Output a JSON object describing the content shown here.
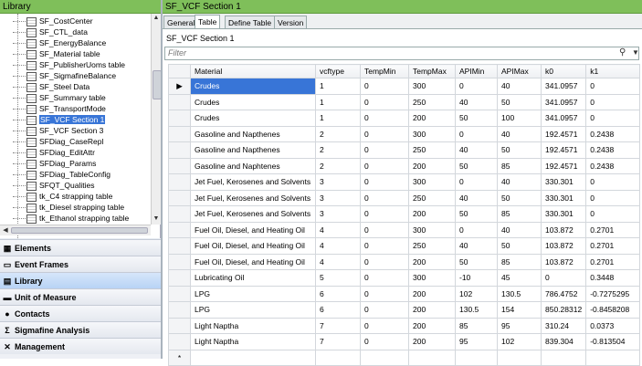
{
  "library": {
    "title": "Library",
    "tree_items": [
      {
        "label": "SF_CostCenter",
        "selected": false
      },
      {
        "label": "SF_CTL_data",
        "selected": false
      },
      {
        "label": "SF_EnergyBalance",
        "selected": false
      },
      {
        "label": "SF_Material table",
        "selected": false
      },
      {
        "label": "SF_PublisherUoms table",
        "selected": false
      },
      {
        "label": "SF_SigmafineBalance",
        "selected": false
      },
      {
        "label": "SF_Steel Data",
        "selected": false
      },
      {
        "label": "SF_Summary table",
        "selected": false
      },
      {
        "label": "SF_TransportMode",
        "selected": false
      },
      {
        "label": "SF_VCF Section 1",
        "selected": true
      },
      {
        "label": "SF_VCF Section 3",
        "selected": false
      },
      {
        "label": "SFDiag_CaseRepl",
        "selected": false
      },
      {
        "label": "SFDiag_EditAttr",
        "selected": false
      },
      {
        "label": "SFDiag_Params",
        "selected": false
      },
      {
        "label": "SFDiag_TableConfig",
        "selected": false
      },
      {
        "label": "SFQT_Qualities",
        "selected": false
      },
      {
        "label": "tk_C4 strapping table",
        "selected": false
      },
      {
        "label": "tk_Diesel strapping table",
        "selected": false
      },
      {
        "label": "tk_Ethanol strapping table",
        "selected": false
      }
    ]
  },
  "nav": [
    {
      "label": "Elements",
      "icon": "elements-icon",
      "glyph": "▦",
      "active": false
    },
    {
      "label": "Event Frames",
      "icon": "event-frames-icon",
      "glyph": "▭",
      "active": false
    },
    {
      "label": "Library",
      "icon": "library-icon",
      "glyph": "▤",
      "active": true
    },
    {
      "label": "Unit of Measure",
      "icon": "ruler-icon",
      "glyph": "▬",
      "active": false
    },
    {
      "label": "Contacts",
      "icon": "contacts-icon",
      "glyph": "●",
      "active": false
    },
    {
      "label": "Sigmafine Analysis",
      "icon": "sigma-icon",
      "glyph": "Σ",
      "active": false
    },
    {
      "label": "Management",
      "icon": "management-icon",
      "glyph": "✕",
      "active": false
    }
  ],
  "section": {
    "title": "SF_VCF Section 1",
    "tabs": [
      "General",
      "Table",
      "Define Table",
      "Version"
    ],
    "active_tab": "Table",
    "subtitle": "SF_VCF Section 1",
    "filter_placeholder": "Filter"
  },
  "grid": {
    "columns": [
      "Material",
      "vcftype",
      "TempMin",
      "TempMax",
      "APIMin",
      "APIMax",
      "k0",
      "k1"
    ],
    "rows": [
      [
        "Crudes",
        "1",
        "0",
        "300",
        "0",
        "40",
        "341.0957",
        "0"
      ],
      [
        "Crudes",
        "1",
        "0",
        "250",
        "40",
        "50",
        "341.0957",
        "0"
      ],
      [
        "Crudes",
        "1",
        "0",
        "200",
        "50",
        "100",
        "341.0957",
        "0"
      ],
      [
        "Gasoline and Napthenes",
        "2",
        "0",
        "300",
        "0",
        "40",
        "192.4571",
        "0.2438"
      ],
      [
        "Gasoline and Napthenes",
        "2",
        "0",
        "250",
        "40",
        "50",
        "192.4571",
        "0.2438"
      ],
      [
        "Gasoline and Naphtenes",
        "2",
        "0",
        "200",
        "50",
        "85",
        "192.4571",
        "0.2438"
      ],
      [
        "Jet Fuel, Kerosenes and Solvents",
        "3",
        "0",
        "300",
        "0",
        "40",
        "330.301",
        "0"
      ],
      [
        "Jet Fuel, Kerosenes and Solvents",
        "3",
        "0",
        "250",
        "40",
        "50",
        "330.301",
        "0"
      ],
      [
        "Jet Fuel, Kerosenes and Solvents",
        "3",
        "0",
        "200",
        "50",
        "85",
        "330.301",
        "0"
      ],
      [
        "Fuel Oil, Diesel, and Heating Oil",
        "4",
        "0",
        "300",
        "0",
        "40",
        "103.872",
        "0.2701"
      ],
      [
        "Fuel Oil, Diesel, and Heating Oil",
        "4",
        "0",
        "250",
        "40",
        "50",
        "103.872",
        "0.2701"
      ],
      [
        "Fuel Oil, Diesel, and Heating Oil",
        "4",
        "0",
        "200",
        "50",
        "85",
        "103.872",
        "0.2701"
      ],
      [
        "Lubricating Oil",
        "5",
        "0",
        "300",
        "-10",
        "45",
        "0",
        "0.3448"
      ],
      [
        "LPG",
        "6",
        "0",
        "200",
        "102",
        "130.5",
        "786.4752",
        "-0.7275295"
      ],
      [
        "LPG",
        "6",
        "0",
        "200",
        "130.5",
        "154",
        "850.28312",
        "-0.8458208"
      ],
      [
        "Light Naptha",
        "7",
        "0",
        "200",
        "85",
        "95",
        "310.24",
        "0.0373"
      ],
      [
        "Light Naptha",
        "7",
        "0",
        "200",
        "95",
        "102",
        "839.304",
        "-0.813504"
      ]
    ],
    "current_row_marker": "▶",
    "new_row_marker": "*"
  }
}
